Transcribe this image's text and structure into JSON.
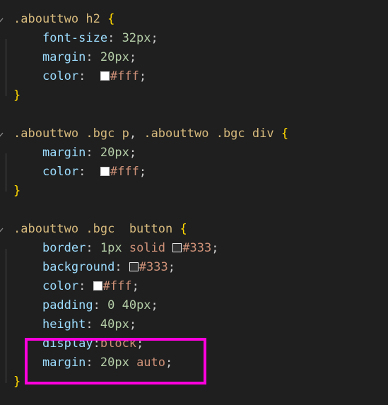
{
  "editor": {
    "background_color": "#1f1f1f",
    "language": "css",
    "highlight_annotation": {
      "color": "#ff00dd",
      "covers_lines": [
        "display:block;",
        "margin: 20px auto;"
      ]
    }
  },
  "colors": {
    "selector": "#d7ba7d",
    "property": "#9cdcfe",
    "number": "#b5cea8",
    "string": "#ce9178",
    "brace": "#ffd700",
    "punctuation": "#cccccc",
    "indent_guide": "#4a4a4a",
    "swatch_fff": "#ffffff",
    "swatch_333": "#333333"
  },
  "rules": [
    {
      "selector_parts": [
        {
          "text": ".abouttwo",
          "type": "class"
        },
        {
          "text": " ",
          "type": "space"
        },
        {
          "text": "h2",
          "type": "tag"
        },
        {
          "text": " ",
          "type": "space"
        },
        {
          "text": "{",
          "type": "brace"
        }
      ],
      "declarations": [
        {
          "property": "font-size",
          "separator": ": ",
          "value_tokens": [
            {
              "text": "32px",
              "type": "number"
            }
          ],
          "terminator": ";",
          "swatch": null
        },
        {
          "property": "margin",
          "separator": ": ",
          "value_tokens": [
            {
              "text": "20px",
              "type": "number"
            }
          ],
          "terminator": ";",
          "swatch": null
        },
        {
          "property": "color",
          "separator": ":  ",
          "value_tokens": [
            {
              "text": "#fff",
              "type": "string"
            }
          ],
          "terminator": ";",
          "swatch": "#ffffff"
        }
      ],
      "close": "}"
    },
    {
      "selector_parts": [
        {
          "text": ".abouttwo",
          "type": "class"
        },
        {
          "text": " ",
          "type": "space"
        },
        {
          "text": ".bgc",
          "type": "class"
        },
        {
          "text": " ",
          "type": "space"
        },
        {
          "text": "p",
          "type": "tag"
        },
        {
          "text": ",",
          "type": "punc"
        },
        {
          "text": " ",
          "type": "space"
        },
        {
          "text": ".abouttwo",
          "type": "class"
        },
        {
          "text": " ",
          "type": "space"
        },
        {
          "text": ".bgc",
          "type": "class"
        },
        {
          "text": " ",
          "type": "space"
        },
        {
          "text": "div",
          "type": "tag"
        },
        {
          "text": " ",
          "type": "space"
        },
        {
          "text": "{",
          "type": "brace"
        }
      ],
      "declarations": [
        {
          "property": "margin",
          "separator": ": ",
          "value_tokens": [
            {
              "text": "20px",
              "type": "number"
            }
          ],
          "terminator": ";",
          "swatch": null
        },
        {
          "property": "color",
          "separator": ":  ",
          "value_tokens": [
            {
              "text": "#fff",
              "type": "string"
            }
          ],
          "terminator": ";",
          "swatch": "#ffffff"
        }
      ],
      "close": "}"
    },
    {
      "selector_parts": [
        {
          "text": ".abouttwo",
          "type": "class"
        },
        {
          "text": " ",
          "type": "space"
        },
        {
          "text": ".bgc",
          "type": "class"
        },
        {
          "text": "  ",
          "type": "space"
        },
        {
          "text": "button",
          "type": "tag"
        },
        {
          "text": " ",
          "type": "space"
        },
        {
          "text": "{",
          "type": "brace"
        }
      ],
      "declarations": [
        {
          "property": "border",
          "separator": ": ",
          "value_tokens": [
            {
              "text": "1px",
              "type": "number"
            },
            {
              "text": " ",
              "type": "space"
            },
            {
              "text": "solid",
              "type": "string"
            },
            {
              "text": " ",
              "type": "space"
            },
            {
              "text": "#333",
              "type": "string"
            }
          ],
          "terminator": ";",
          "swatch": "#333333"
        },
        {
          "property": "background",
          "separator": ": ",
          "value_tokens": [
            {
              "text": "#333",
              "type": "string"
            }
          ],
          "terminator": ";",
          "swatch": "#333333"
        },
        {
          "property": "color",
          "separator": ": ",
          "value_tokens": [
            {
              "text": "#fff",
              "type": "string"
            }
          ],
          "terminator": ";",
          "swatch": "#ffffff"
        },
        {
          "property": "padding",
          "separator": ": ",
          "value_tokens": [
            {
              "text": "0",
              "type": "number"
            },
            {
              "text": " ",
              "type": "space"
            },
            {
              "text": "40px",
              "type": "number"
            }
          ],
          "terminator": ";",
          "swatch": null
        },
        {
          "property": "height",
          "separator": ": ",
          "value_tokens": [
            {
              "text": "40px",
              "type": "number"
            }
          ],
          "terminator": ";",
          "swatch": null
        },
        {
          "property": "display",
          "separator": ":",
          "value_tokens": [
            {
              "text": "block",
              "type": "string"
            }
          ],
          "terminator": ";",
          "swatch": null,
          "highlighted": true
        },
        {
          "property": "margin",
          "separator": ": ",
          "value_tokens": [
            {
              "text": "20px",
              "type": "number"
            },
            {
              "text": " ",
              "type": "space"
            },
            {
              "text": "auto",
              "type": "string"
            }
          ],
          "terminator": ";",
          "swatch": null,
          "highlighted": true
        }
      ],
      "close": "}"
    }
  ],
  "gutter": {
    "fold_icon": "chevron-down-icon",
    "fold_markers": 3
  }
}
